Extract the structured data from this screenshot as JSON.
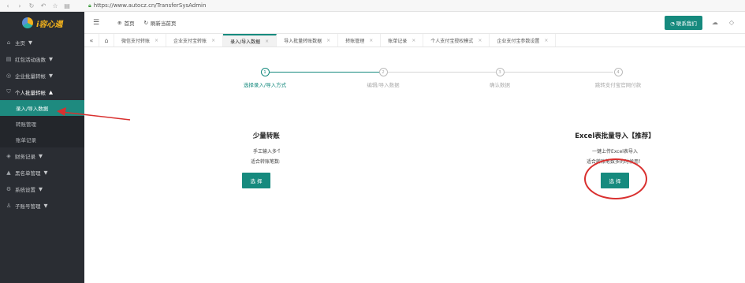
{
  "browser": {
    "url": "https://www.autocz.cn/TransferSysAdmin"
  },
  "sidebar": {
    "logo_text": "i容心遏",
    "items": [
      {
        "label": "主页",
        "icon": "home-icon",
        "glyph": "⌂",
        "suffix": "▼"
      },
      {
        "label": "红包活动函数",
        "icon": "gift-icon",
        "glyph": "▤",
        "suffix": "▼"
      },
      {
        "label": "企业批量转帐",
        "icon": "coin-icon",
        "glyph": "◎",
        "suffix": "▼"
      },
      {
        "label": "个人批量转帐",
        "icon": "shield-icon",
        "glyph": "⛉",
        "suffix": "▲"
      }
    ],
    "sub_items": [
      {
        "label": "录入/导入数据"
      },
      {
        "label": "转账管理"
      },
      {
        "label": "账单记录"
      }
    ],
    "items_after": [
      {
        "label": "财务记录",
        "icon": "finance-icon",
        "glyph": "◈",
        "suffix": "▼"
      },
      {
        "label": "黑名单管理",
        "icon": "user-icon",
        "glyph": "▲",
        "suffix": "▼"
      },
      {
        "label": "系统设置",
        "icon": "gear-icon",
        "glyph": "⚙",
        "suffix": "▼"
      },
      {
        "label": "子账号管理",
        "icon": "account-icon",
        "glyph": "♙",
        "suffix": "▼"
      }
    ]
  },
  "header": {
    "home_label": "首页",
    "refresh_label": "刷新当前页",
    "contact_label": "联系我们"
  },
  "tabs": [
    {
      "label": "微信支付转账"
    },
    {
      "label": "企业支付宝转账"
    },
    {
      "label": "录入/导入数据"
    },
    {
      "label": "导入批量转账数据"
    },
    {
      "label": "转账管理"
    },
    {
      "label": "账单记录"
    },
    {
      "label": "个人支付宝授权模式"
    },
    {
      "label": "企业支付宝参数设置"
    }
  ],
  "steps": [
    {
      "num": "1",
      "label": "选择录入/导入方式"
    },
    {
      "num": "2",
      "label": "编辑/导入数据"
    },
    {
      "num": "3",
      "label": "确认数据"
    },
    {
      "num": "4",
      "label": "跳转支付宝官网付款"
    }
  ],
  "cards": {
    "manual": {
      "title": "少量转账需",
      "line1": "手工输入多个账",
      "line2": "适合转账笔数少的",
      "button": "选 择"
    },
    "excel": {
      "title": "Excel表批量导入【推荐】",
      "line1": "一键上传Excel表导入",
      "line2": "适合转账笔数多的时候用！",
      "button": "选 择"
    }
  },
  "colors": {
    "accent": "#168a7e",
    "sidebar": "#2a2d33",
    "annotation": "#d9302f"
  }
}
